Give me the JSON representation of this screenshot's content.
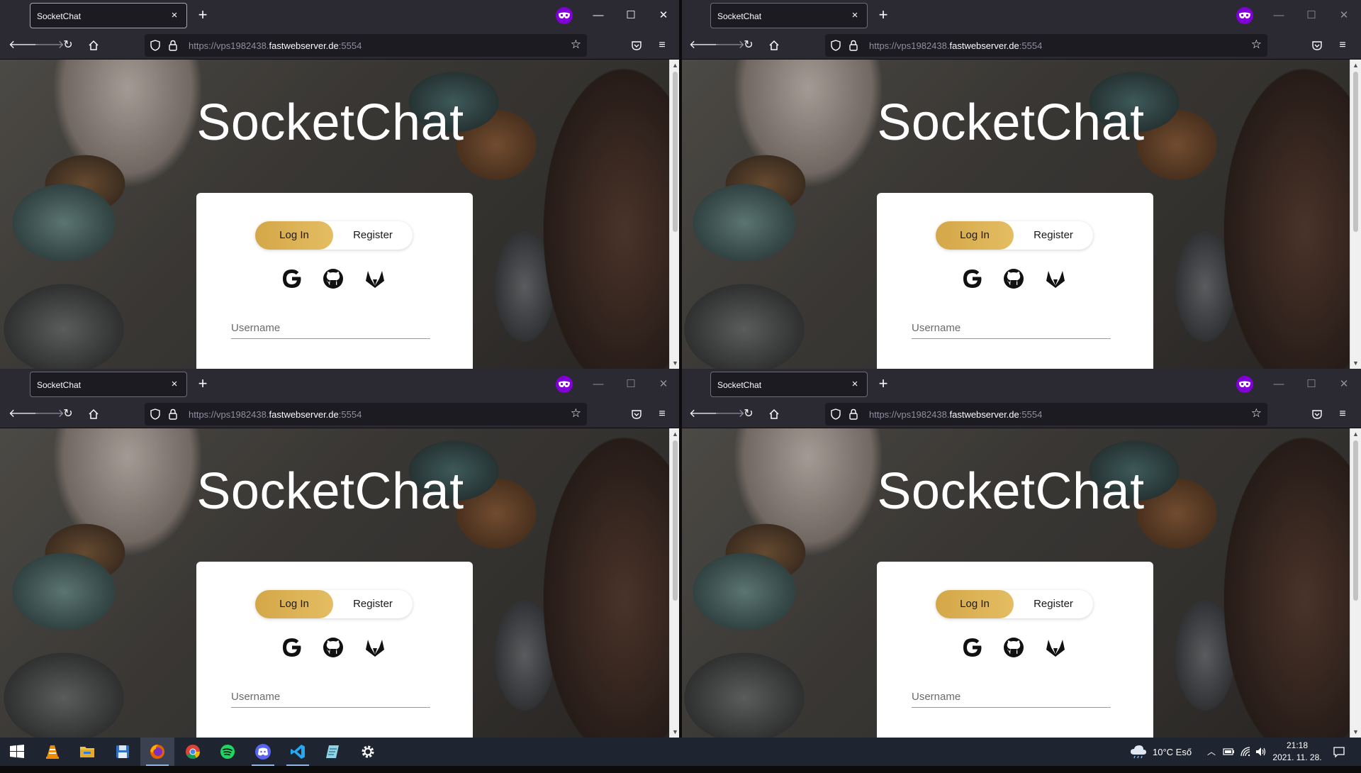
{
  "browser": {
    "tab_title": "SocketChat",
    "tab_close": "×",
    "new_tab": "+",
    "url_prefix": "https://vps1982438.",
    "url_host": "fastwebserver.de",
    "url_suffix": ":5554",
    "window_controls": {
      "minimize": "—",
      "maximize": "☐",
      "close": "✕"
    }
  },
  "page": {
    "title": "SocketChat",
    "toggle": {
      "login": "Log In",
      "register": "Register"
    },
    "username_placeholder": "Username",
    "accent_color": "#d9ad4f"
  },
  "oauth_icons": [
    "google-icon",
    "github-icon",
    "gitlab-icon"
  ],
  "taskbar": {
    "apps": [
      "windows-start-icon",
      "vlc-icon",
      "file-explorer-icon",
      "floppy-save-icon",
      "firefox-icon",
      "chrome-icon",
      "spotify-icon",
      "discord-icon",
      "vscode-icon",
      "notepad-icon",
      "settings-icon"
    ],
    "weather": "10°C  Eső",
    "time": "21:18",
    "date": "2021. 11. 28."
  }
}
